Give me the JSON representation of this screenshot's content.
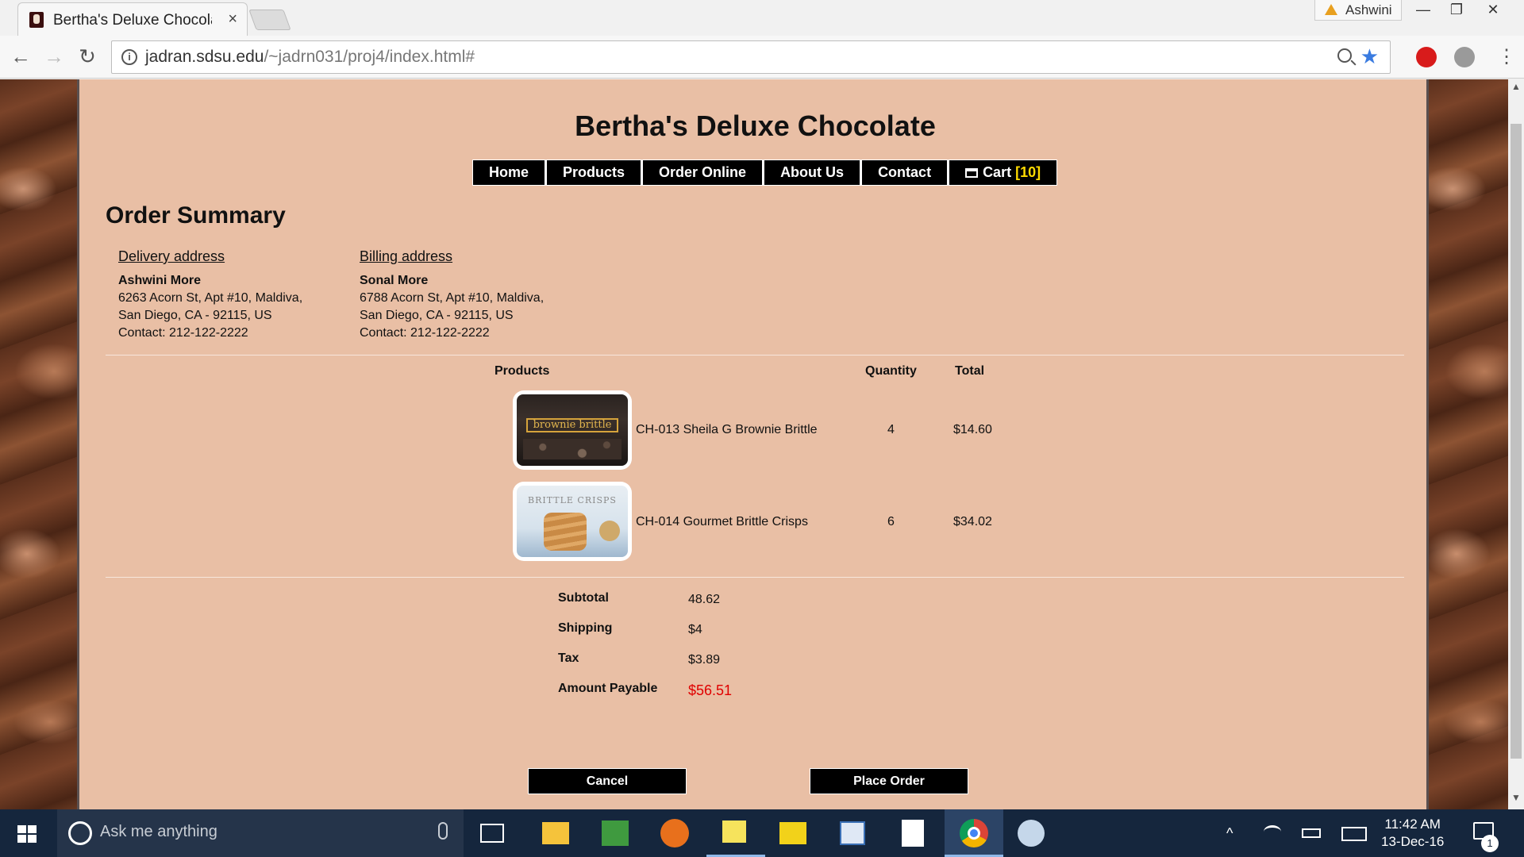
{
  "browser": {
    "tab_title": "Bertha's Deluxe Chocolat",
    "tab_close": "×",
    "profile_name": "Ashwini",
    "url_host": "jadran.sdsu.edu",
    "url_path": "/~jadrn031/proj4/index.html#",
    "back_glyph": "←",
    "forward_glyph": "→",
    "reload_glyph": "↻",
    "star_glyph": "★",
    "menu_glyph": "⋮",
    "win_min": "—",
    "win_max": "❐",
    "win_close": "✕"
  },
  "site": {
    "title": "Bertha's Deluxe Chocolate",
    "nav": [
      "Home",
      "Products",
      "Order Online",
      "About Us",
      "Contact"
    ],
    "cart_label": "Cart",
    "cart_count": "[10]"
  },
  "order": {
    "heading": "Order Summary",
    "delivery": {
      "heading": "Delivery address",
      "name": "Ashwini More",
      "line1": "6263 Acorn St, Apt #10, Maldiva,",
      "line2": "San Diego, CA - 92115, US",
      "contact": "Contact: 212-122-2222"
    },
    "billing": {
      "heading": "Billing address",
      "name": "Sonal More",
      "line1": "6788 Acorn St, Apt #10, Maldiva,",
      "line2": "San Diego, CA - 92115, US",
      "contact": "Contact: 212-122-2222"
    },
    "columns": [
      "Products",
      "Quantity",
      "Total"
    ],
    "items": [
      {
        "name": "CH-013 Sheila G Brownie Brittle",
        "qty": "4",
        "total": "$14.60",
        "image_label": "brownie brittle",
        "image": "brownie-brittle-bag"
      },
      {
        "name": "CH-014 Gourmet Brittle Crisps",
        "qty": "6",
        "total": "$34.02",
        "image_label": "BRITTLE CRISPS",
        "image": "brittle-crisps-bag"
      }
    ],
    "summary": {
      "subtotal_label": "Subtotal",
      "subtotal": "48.62",
      "shipping_label": "Shipping",
      "shipping": "$4",
      "tax_label": "Tax",
      "tax": "$3.89",
      "amount_label": "Amount Payable",
      "amount": "$56.51"
    },
    "cancel_label": "Cancel",
    "place_order_label": "Place Order"
  },
  "taskbar": {
    "search_placeholder": "Ask me anything",
    "time": "11:42 AM",
    "date": "13-Dec-16",
    "notification_count": "1"
  },
  "colors": {
    "content_bg": "#e9bfa5",
    "nav_bg": "#000000",
    "cart_count": "#ffdb00",
    "amount_payable": "#e00000",
    "taskbar": "#15263d"
  }
}
